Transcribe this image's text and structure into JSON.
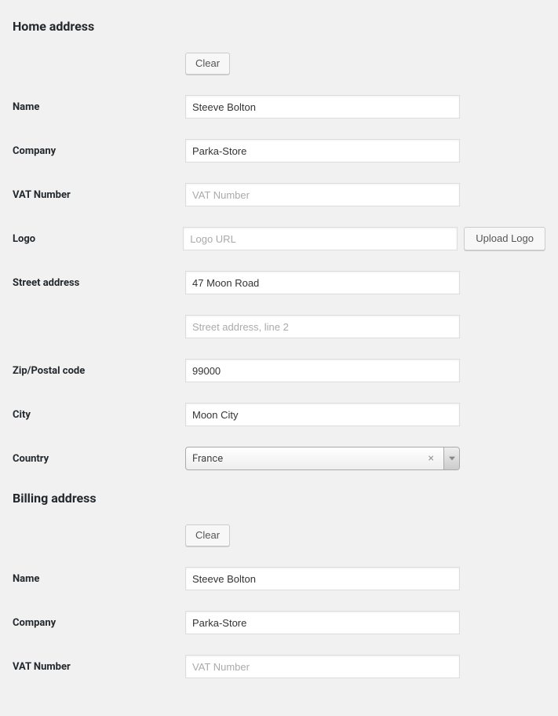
{
  "home": {
    "title": "Home address",
    "clear_label": "Clear",
    "name_label": "Name",
    "name_value": "Steeve Bolton",
    "company_label": "Company",
    "company_value": "Parka-Store",
    "vat_label": "VAT Number",
    "vat_value": "",
    "vat_placeholder": "VAT Number",
    "logo_label": "Logo",
    "logo_value": "",
    "logo_placeholder": "Logo URL",
    "upload_label": "Upload Logo",
    "street_label": "Street address",
    "street_value": "47 Moon Road",
    "street2_value": "",
    "street2_placeholder": "Street address, line 2",
    "zip_label": "Zip/Postal code",
    "zip_value": "99000",
    "city_label": "City",
    "city_value": "Moon City",
    "country_label": "Country",
    "country_value": "France"
  },
  "billing": {
    "title": "Billing address",
    "clear_label": "Clear",
    "name_label": "Name",
    "name_value": "Steeve Bolton",
    "company_label": "Company",
    "company_value": "Parka-Store",
    "vat_label": "VAT Number",
    "vat_value": "",
    "vat_placeholder": "VAT Number"
  }
}
